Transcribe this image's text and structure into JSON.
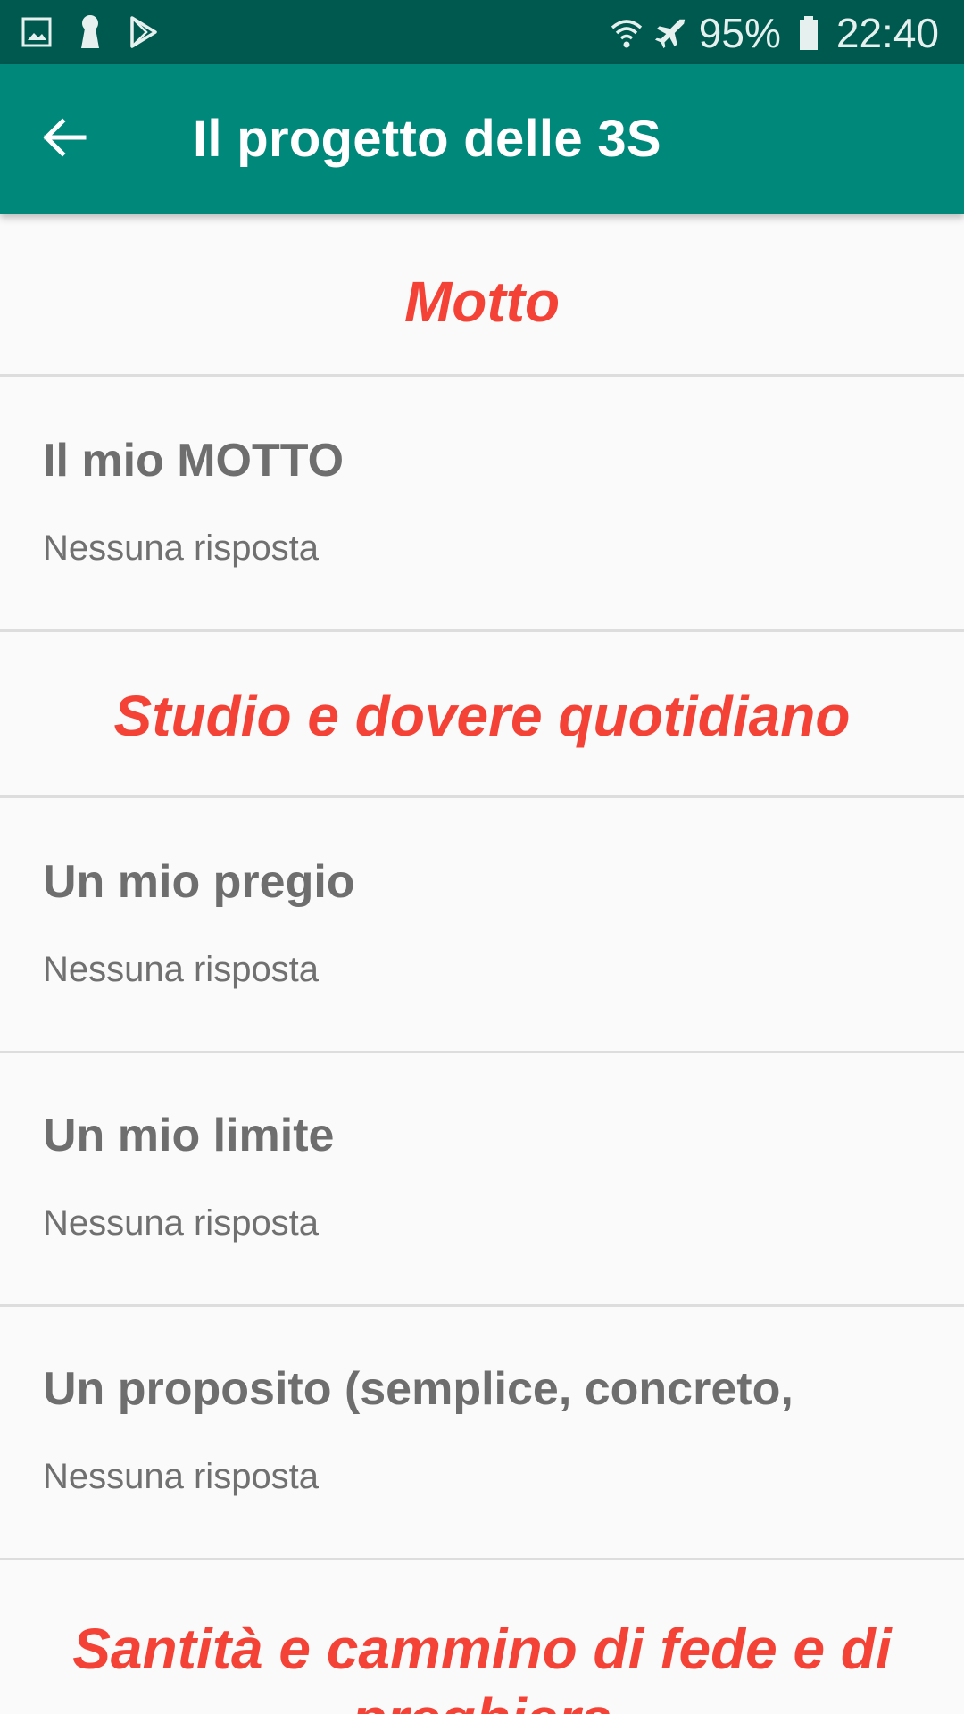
{
  "status_bar": {
    "icons_left": [
      "gallery-icon",
      "keyhole-icon",
      "play-store-icon"
    ],
    "icons_right": [
      "wifi-icon",
      "airplane-icon",
      "battery-icon"
    ],
    "battery": "95%",
    "time": "22:40"
  },
  "app_bar": {
    "title": "Il progetto delle 3S",
    "back_icon": "arrow-left-icon"
  },
  "sections": {
    "motto": "Motto",
    "studio": "Studio e dovere quotidiano",
    "santita": "Santità e cammino di fede e di preghiera"
  },
  "items": {
    "motto_title": "Il mio MOTTO",
    "motto_answer": "Nessuna risposta",
    "pregio_title": "Un mio pregio",
    "pregio_answer": "Nessuna risposta",
    "limite_title": "Un mio limite",
    "limite_answer": "Nessuna risposta",
    "proposito_title": "Un proposito (semplice, concreto,",
    "proposito_answer": "Nessuna risposta"
  },
  "colors": {
    "status_bar": "#00594f",
    "app_bar": "#00897b",
    "section_header": "#f44336",
    "item_title": "#6e6e6e",
    "divider": "#dddddd",
    "background": "#fafafa"
  }
}
